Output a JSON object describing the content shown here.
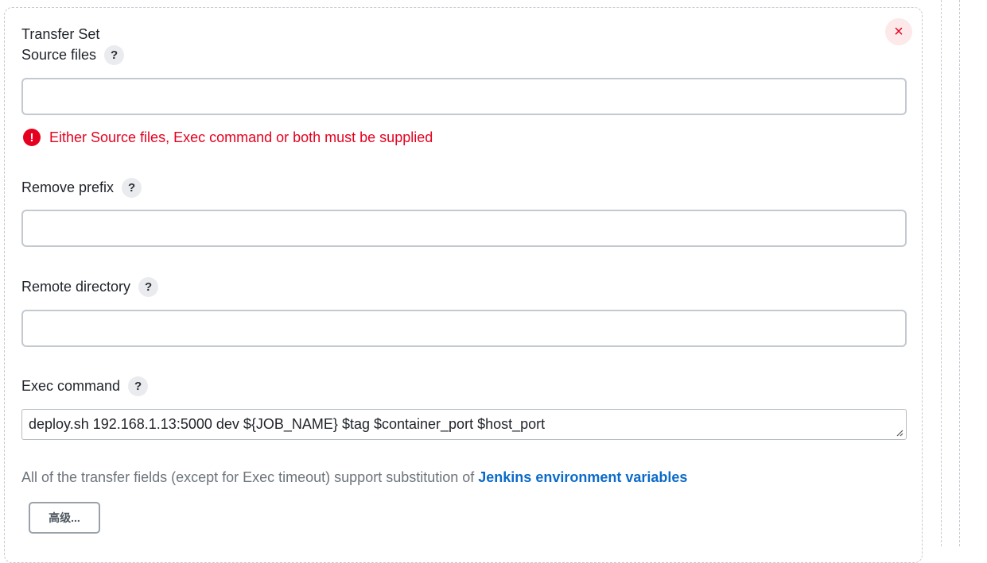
{
  "transfer_set": {
    "title": "Transfer Set",
    "close_symbol": "×",
    "help_symbol": "?",
    "source_files": {
      "label": "Source files",
      "value": "",
      "error_icon_symbol": "!",
      "error": "Either Source files, Exec command or both must be supplied"
    },
    "remove_prefix": {
      "label": "Remove prefix",
      "value": ""
    },
    "remote_directory": {
      "label": "Remote directory",
      "value": ""
    },
    "exec_command": {
      "label": "Exec command",
      "value": "deploy.sh 192.168.1.13:5000 dev ${JOB_NAME} $tag $container_port $host_port"
    },
    "info": {
      "text": "All of the transfer fields (except for Exec timeout) support substitution of ",
      "link": "Jenkins environment variables"
    },
    "advanced_button": "高级..."
  },
  "colors": {
    "error": "#e6001f",
    "link": "#0b6ac9",
    "border": "#c3c9cf"
  }
}
